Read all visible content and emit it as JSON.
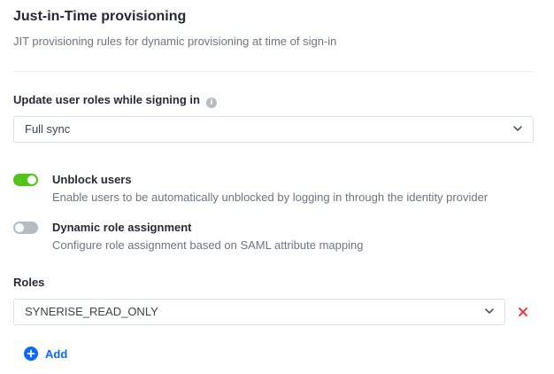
{
  "section": {
    "title": "Just-in-Time provisioning",
    "subtitle": "JIT provisioning rules for dynamic provisioning at time of sign-in"
  },
  "update_roles": {
    "label": "Update user roles while signing in",
    "info_icon": "info-icon",
    "selected": "Full sync"
  },
  "options": [
    {
      "title": "Unblock users",
      "description": "Enable users to be automatically unblocked by logging in through the identity provider",
      "enabled": true
    },
    {
      "title": "Dynamic role assignment",
      "description": "Configure role assignment based on SAML attribute mapping",
      "enabled": false
    }
  ],
  "roles": {
    "label": "Roles",
    "items": [
      "SYNERISE_READ_ONLY"
    ],
    "add_label": "Add"
  },
  "colors": {
    "toggle_on": "#52c41a",
    "toggle_off": "#b5bdc3",
    "accent_blue": "#0b68ff",
    "danger_red": "#f5222d"
  }
}
